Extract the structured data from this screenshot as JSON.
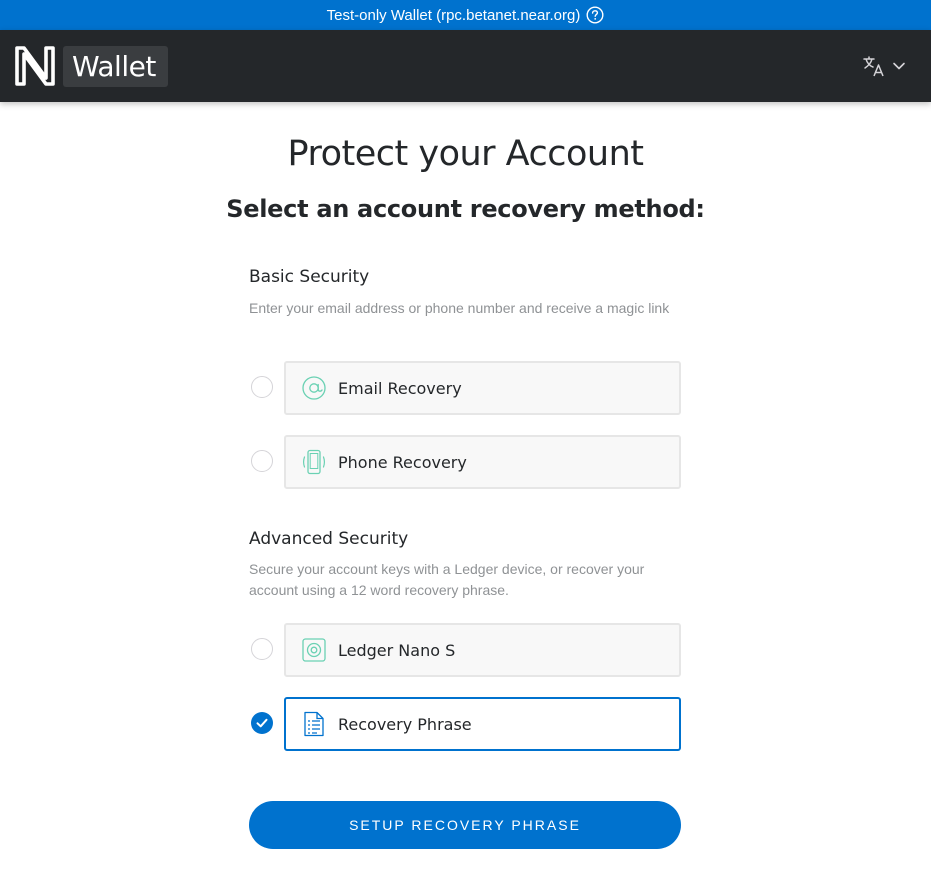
{
  "banner": {
    "text": "Test-only Wallet (rpc.betanet.near.org)",
    "icon": "help-circle-icon"
  },
  "navbar": {
    "logo_icon": "near-logo-icon",
    "wallet_label": "Wallet",
    "language_icon": "translate-icon",
    "dropdown_icon": "chevron-down-icon"
  },
  "page": {
    "title": "Protect your Account",
    "subtitle": "Select an account recovery method:"
  },
  "basic_security": {
    "heading": "Basic Security",
    "description": "Enter your email address or phone number and receive a magic link",
    "options": [
      {
        "label": "Email Recovery",
        "icon": "at-sign-icon",
        "selected": false
      },
      {
        "label": "Phone Recovery",
        "icon": "phone-icon",
        "selected": false
      }
    ]
  },
  "advanced_security": {
    "heading": "Advanced Security",
    "description": "Secure your account keys with a Ledger device, or recover your account using a 12 word recovery phrase.",
    "options": [
      {
        "label": "Ledger Nano S",
        "icon": "ledger-icon",
        "selected": false
      },
      {
        "label": "Recovery Phrase",
        "icon": "document-icon",
        "selected": true
      }
    ]
  },
  "cta": {
    "label": "SETUP RECOVERY PHRASE"
  },
  "colors": {
    "accent": "#0072ce",
    "navbar": "#24272a",
    "card_bg": "#f8f8f8",
    "icon_green": "#6ad1b3"
  }
}
